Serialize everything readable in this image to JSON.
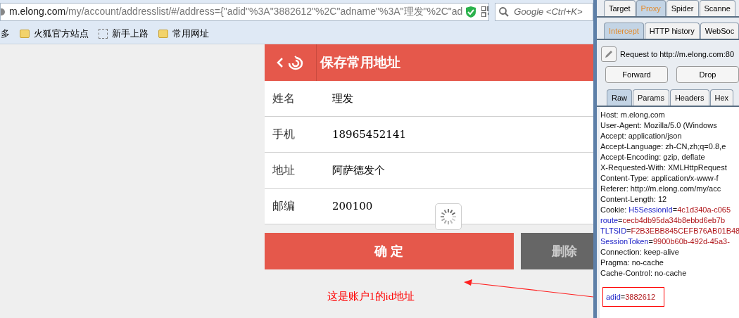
{
  "browser": {
    "url_host": "m.elong.com",
    "url_path": "/my/account/addresslist/#/address={\"adid\"%3A\"3882612\"%2C\"adname\"%3A\"理发\"%2C\"ad",
    "search": {
      "placeholder": "Google <Ctrl+K>"
    },
    "bookmarks": [
      {
        "label": "多",
        "kind": "plain"
      },
      {
        "label": "火狐官方站点",
        "kind": "folder"
      },
      {
        "label": "新手上路",
        "kind": "page"
      },
      {
        "label": "常用网址",
        "kind": "folder"
      }
    ]
  },
  "page": {
    "title": "保存常用地址",
    "fields": [
      {
        "label": "姓名",
        "value": "理发"
      },
      {
        "label": "手机",
        "value": "18965452141"
      },
      {
        "label": "地址",
        "value": "阿萨德发个"
      },
      {
        "label": "邮编",
        "value": "200100"
      }
    ],
    "buttons": [
      {
        "label": "确 定",
        "kind": "primary"
      },
      {
        "label": "删除",
        "kind": "secondary"
      }
    ],
    "annotation": "这是账户1的id地址"
  },
  "proxy": {
    "tabs": [
      {
        "label": "Target",
        "selected": false
      },
      {
        "label": "Proxy",
        "selected": true
      },
      {
        "label": "Spider",
        "selected": false
      },
      {
        "label": "Scanne",
        "selected": false
      }
    ],
    "subtabs": [
      {
        "label": "Intercept",
        "selected": true
      },
      {
        "label": "HTTP history",
        "selected": false
      },
      {
        "label": "WebSoc",
        "selected": false
      }
    ],
    "request_line": "Request to http://m.elong.com:80",
    "actions": [
      "Forward",
      "Drop"
    ],
    "message_tabs": [
      {
        "label": "Raw",
        "selected": true
      },
      {
        "label": "Params",
        "selected": false
      },
      {
        "label": "Headers",
        "selected": false
      },
      {
        "label": "Hex",
        "selected": false
      }
    ],
    "lines": [
      [
        {
          "kind": "plain",
          "text": "Host: m.elong.com"
        }
      ],
      [
        {
          "kind": "plain",
          "text": "User-Agent: Mozilla/5.0 (Windows"
        }
      ],
      [
        {
          "kind": "plain",
          "text": "Accept: application/json"
        }
      ],
      [
        {
          "kind": "plain",
          "text": "Accept-Language: zh-CN,zh;q=0.8,e"
        }
      ],
      [
        {
          "kind": "plain",
          "text": "Accept-Encoding: gzip, deflate"
        }
      ],
      [
        {
          "kind": "plain",
          "text": "X-Requested-With: XMLHttpRequest"
        }
      ],
      [
        {
          "kind": "plain",
          "text": "Content-Type: application/x-www-f"
        }
      ],
      [
        {
          "kind": "plain",
          "text": "Referer: http://m.elong.com/my/acc"
        }
      ],
      [
        {
          "kind": "plain",
          "text": "Content-Length: 12"
        }
      ],
      [
        {
          "kind": "plain",
          "text": "Cookie: "
        },
        {
          "kind": "name",
          "text": "H5SessionId"
        },
        {
          "kind": "plain",
          "text": "="
        },
        {
          "kind": "value",
          "text": "4c1d340a-c065"
        }
      ],
      [
        {
          "kind": "name",
          "text": "route"
        },
        {
          "kind": "plain",
          "text": "="
        },
        {
          "kind": "value",
          "text": "cecb4db95da34b8ebbd6eb7b"
        }
      ],
      [
        {
          "kind": "name",
          "text": "TLTSID"
        },
        {
          "kind": "plain",
          "text": "="
        },
        {
          "kind": "value",
          "text": "F2B3EBB845CEFB76AB01B48"
        }
      ],
      [
        {
          "kind": "name",
          "text": "SessionToken"
        },
        {
          "kind": "plain",
          "text": "="
        },
        {
          "kind": "value",
          "text": "9900b60b-492d-45a3-"
        }
      ],
      [
        {
          "kind": "plain",
          "text": "Connection: keep-alive"
        }
      ],
      [
        {
          "kind": "plain",
          "text": "Pragma: no-cache"
        }
      ],
      [
        {
          "kind": "plain",
          "text": "Cache-Control: no-cache"
        }
      ]
    ],
    "body": {
      "name": "adid",
      "separator": "=",
      "value": "3882612"
    }
  }
}
